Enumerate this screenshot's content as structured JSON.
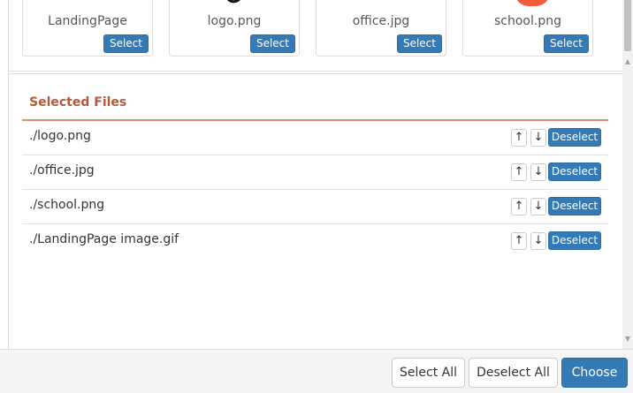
{
  "gallery": {
    "cards": [
      {
        "name": "LandingPage",
        "select_label": "Select"
      },
      {
        "name": "logo.png",
        "select_label": "Select"
      },
      {
        "name": "office.jpg",
        "select_label": "Select"
      },
      {
        "name": "school.png",
        "select_label": "Select"
      }
    ]
  },
  "selected": {
    "title": "Selected Files",
    "files": [
      {
        "path": "./logo.png",
        "up": "↑",
        "down": "↓",
        "deselect_label": "Deselect"
      },
      {
        "path": "./office.jpg",
        "up": "↑",
        "down": "↓",
        "deselect_label": "Deselect"
      },
      {
        "path": "./school.png",
        "up": "↑",
        "down": "↓",
        "deselect_label": "Deselect"
      },
      {
        "path": "./LandingPage image.gif",
        "up": "↑",
        "down": "↓",
        "deselect_label": "Deselect"
      }
    ]
  },
  "footer": {
    "select_all_label": "Select All",
    "deselect_all_label": "Deselect All",
    "choose_label": "Choose"
  },
  "colors": {
    "primary": "#337ab7",
    "section_title": "#b4583a",
    "school_thumb": "#f25c3b"
  },
  "icons": {
    "up": "arrow-up-icon",
    "down": "arrow-down-icon",
    "scroll_up": "scroll-up-arrow-icon",
    "scroll_down": "scroll-down-arrow-icon"
  }
}
